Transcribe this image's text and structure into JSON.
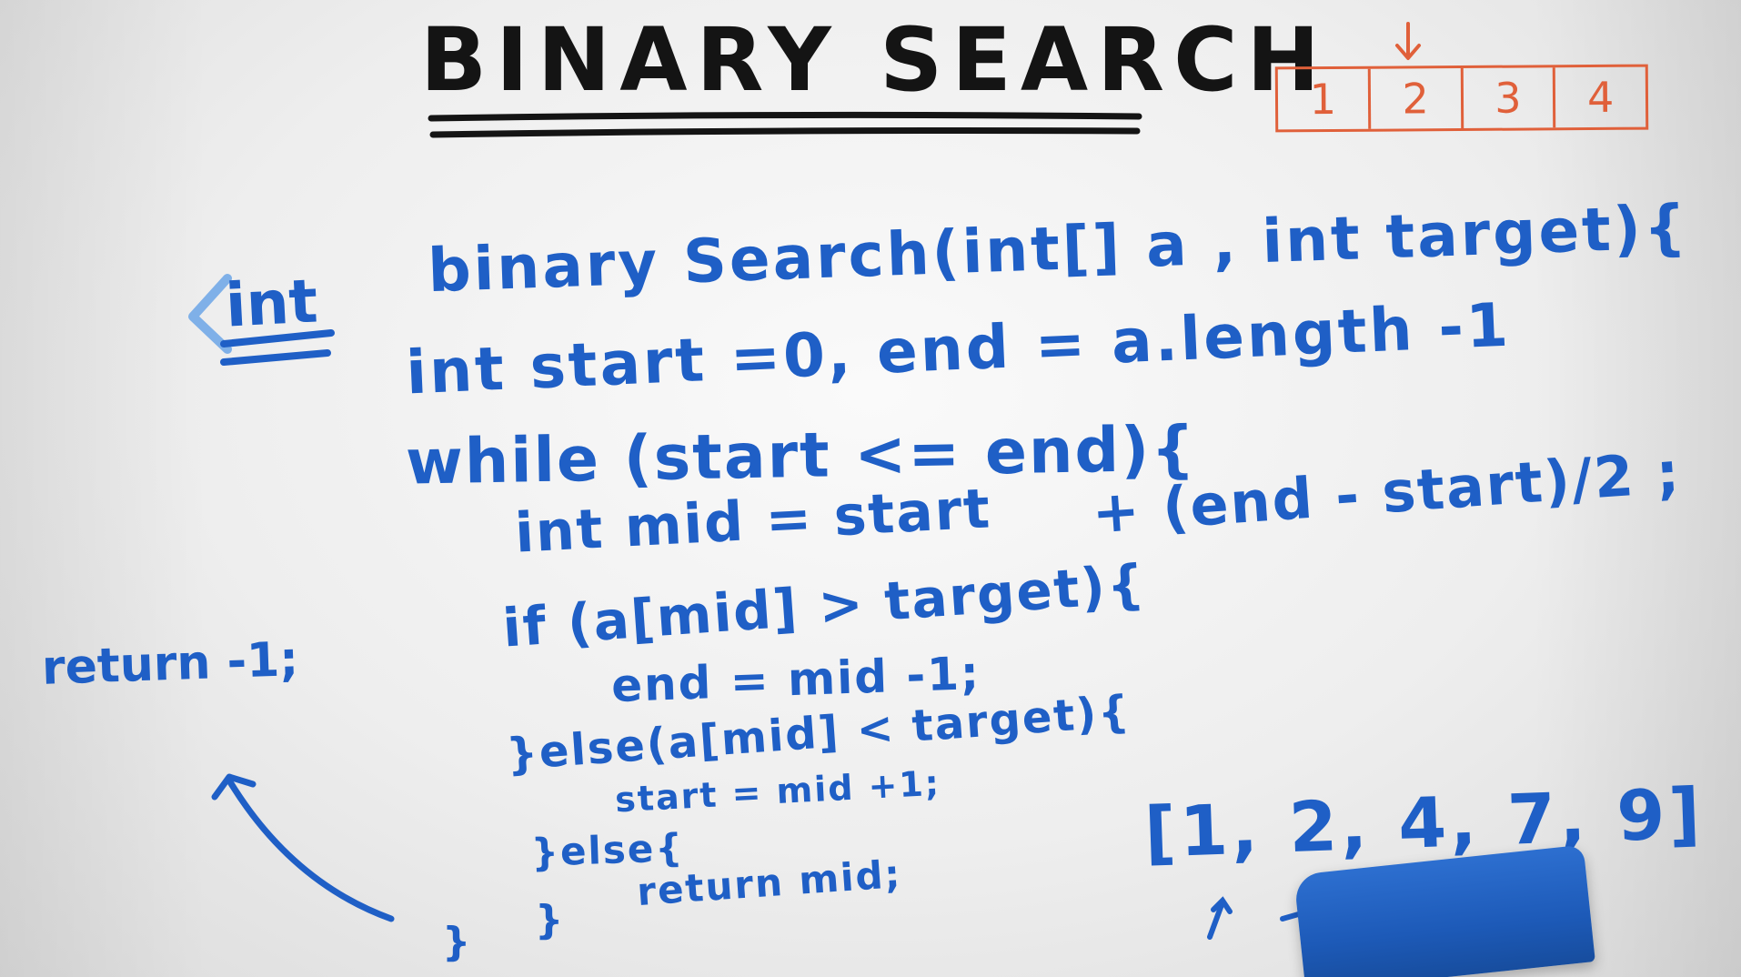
{
  "board": {
    "title": "BINARY SEARCH",
    "array_cells": [
      "1",
      "2",
      "3",
      "4"
    ],
    "colors": {
      "ink_blue": "#1f5fc6",
      "ink_black": "#141414",
      "ink_orange": "#e0603a",
      "board": "#f2f2f2"
    }
  },
  "code": {
    "return_type": "int",
    "lines": [
      "binary Search(int[] a , int target){",
      "int start =0, end = a.length -1",
      "while (start <= end){",
      "int mid = start",
      "+ (end - start)/2 ;",
      "if (a[mid] > target){",
      "end = mid -1;",
      "}else(a[mid] < target){",
      "start = mid +1;",
      "}else{",
      "return mid;",
      "}",
      "}"
    ]
  },
  "side_note": "return -1;",
  "example": {
    "array_text": "[1, 2, 4, 7, 9]"
  },
  "icons": {
    "pointer": "down-arrow-icon",
    "curve": "curved-arrow-icon",
    "return_marker": "left-chevron-icon"
  }
}
